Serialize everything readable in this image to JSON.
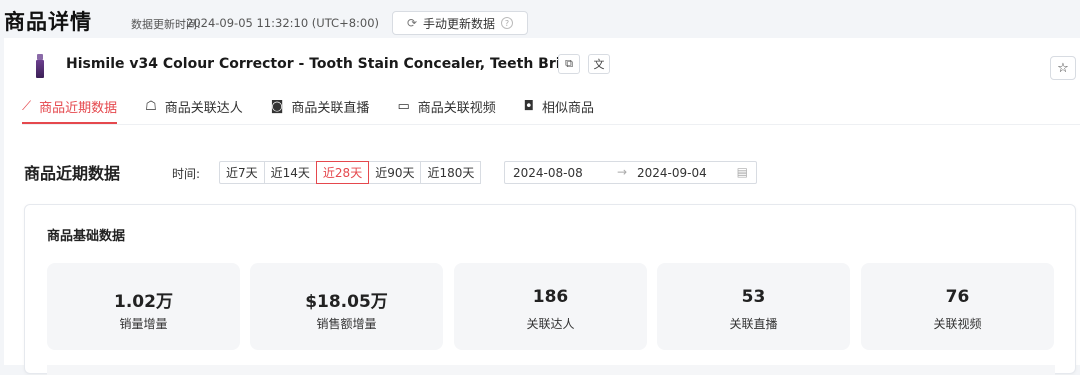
{
  "header": {
    "title": "商品详情",
    "update_label": "数据更新时间:",
    "update_time": "2024-09-05 11:32:10 (UTC+8:00)",
    "update_button": "手动更新数据"
  },
  "product": {
    "title": "Hismile v34 Colour Corrector - Tooth Stain Concealer, Teeth Bri..."
  },
  "tabs": [
    {
      "label": "商品近期数据",
      "icon": "chart-line-icon"
    },
    {
      "label": "商品关联达人",
      "icon": "handshake-icon"
    },
    {
      "label": "商品关联直播",
      "icon": "live-tv-icon"
    },
    {
      "label": "商品关联视频",
      "icon": "video-icon"
    },
    {
      "label": "相似商品",
      "icon": "bag-icon"
    }
  ],
  "recent": {
    "title": "商品近期数据",
    "time_label": "时间:",
    "ranges": [
      "近7天",
      "近14天",
      "近28天",
      "近90天",
      "近180天"
    ],
    "active_range": "近28天",
    "start_date": "2024-08-08",
    "end_date": "2024-09-04"
  },
  "basic": {
    "title": "商品基础数据",
    "metrics": [
      {
        "value": "1.02万",
        "label": "销量增量"
      },
      {
        "value": "$18.05万",
        "label": "销售额增量"
      },
      {
        "value": "186",
        "label": "关联达人"
      },
      {
        "value": "53",
        "label": "关联直播"
      },
      {
        "value": "76",
        "label": "关联视频"
      }
    ]
  },
  "colors": {
    "accent": "#e5484d"
  }
}
